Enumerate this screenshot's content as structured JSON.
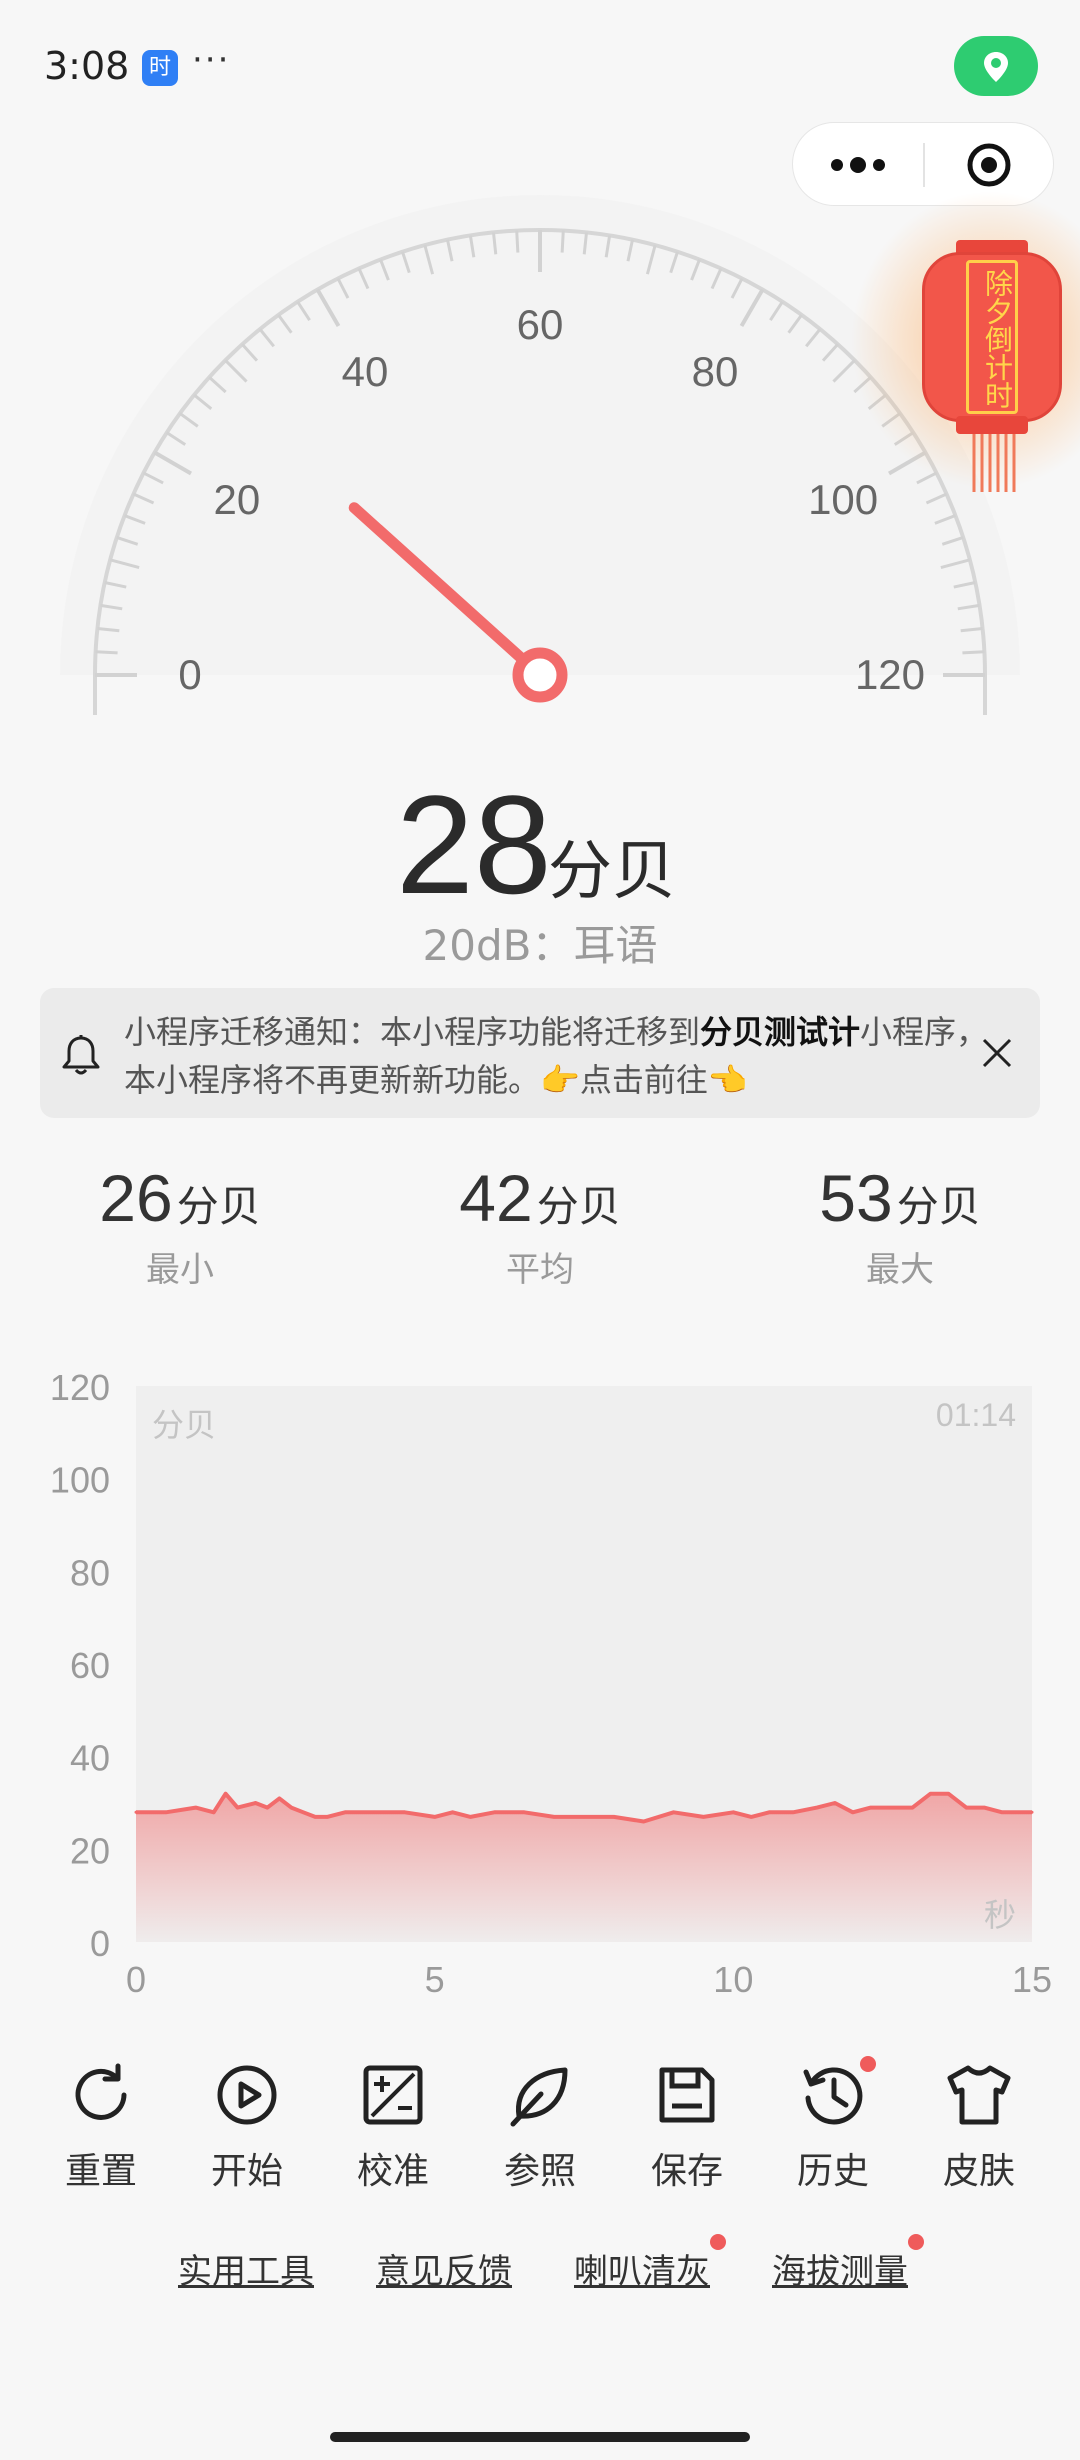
{
  "status_bar": {
    "time": "3:08",
    "app_icon_char": "时",
    "more": "···"
  },
  "gauge": {
    "ticks": [
      "0",
      "20",
      "40",
      "60",
      "80",
      "100",
      "120"
    ],
    "min": 0,
    "max": 120,
    "needle_value": 28
  },
  "lantern": {
    "label": "除夕倒计时"
  },
  "reading": {
    "value": "28",
    "unit": "分贝",
    "level": "20dB：耳语"
  },
  "notice": {
    "prefix": "小程序迁移通知：本小程序功能将迁移到",
    "highlight": "分贝测试计",
    "suffix": "小程序，本小程序将不再更新新功能。👉点击前往👈"
  },
  "stats": [
    {
      "value": "26",
      "unit": "分贝",
      "label": "最小"
    },
    {
      "value": "42",
      "unit": "分贝",
      "label": "平均"
    },
    {
      "value": "53",
      "unit": "分贝",
      "label": "最大"
    }
  ],
  "chart_data": {
    "type": "area",
    "ylabel": "分贝",
    "xlabel": "秒",
    "timestamp": "01:14",
    "ylim": [
      0,
      120
    ],
    "xlim": [
      0,
      15
    ],
    "y_ticks": [
      "120",
      "100",
      "80",
      "60",
      "40",
      "20",
      "0"
    ],
    "x_ticks": [
      "0",
      "5",
      "10",
      "15"
    ],
    "x": [
      0,
      0.5,
      1.0,
      1.3,
      1.5,
      1.7,
      2.0,
      2.2,
      2.4,
      2.6,
      2.8,
      3.0,
      3.2,
      3.5,
      4.0,
      4.5,
      5.0,
      5.3,
      5.6,
      6.0,
      6.5,
      7.0,
      7.5,
      8.0,
      8.5,
      9.0,
      9.5,
      10.0,
      10.3,
      10.6,
      11.0,
      11.4,
      11.7,
      12.0,
      12.3,
      12.6,
      13.0,
      13.3,
      13.6,
      13.9,
      14.2,
      14.5,
      15.0
    ],
    "values": [
      28,
      28,
      29,
      28,
      32,
      29,
      30,
      29,
      31,
      29,
      28,
      27,
      27,
      28,
      28,
      28,
      27,
      28,
      27,
      28,
      28,
      27,
      27,
      27,
      26,
      28,
      27,
      28,
      27,
      28,
      28,
      29,
      30,
      28,
      29,
      29,
      29,
      32,
      32,
      29,
      29,
      28,
      28
    ],
    "line_color": "#f26b6b"
  },
  "toolbar": [
    {
      "name": "reset",
      "label": "重置",
      "icon": "refresh-icon"
    },
    {
      "name": "start",
      "label": "开始",
      "icon": "play-icon"
    },
    {
      "name": "calibrate",
      "label": "校准",
      "icon": "calibrate-icon"
    },
    {
      "name": "reference",
      "label": "参照",
      "icon": "leaf-icon"
    },
    {
      "name": "save",
      "label": "保存",
      "icon": "save-icon"
    },
    {
      "name": "history",
      "label": "历史",
      "icon": "history-icon"
    },
    {
      "name": "skin",
      "label": "皮肤",
      "icon": "shirt-icon"
    }
  ],
  "links": [
    {
      "label": "实用工具"
    },
    {
      "label": "意见反馈"
    },
    {
      "label": "喇叭清灰"
    },
    {
      "label": "海拔测量"
    }
  ],
  "colors": {
    "accent": "#f26b6b",
    "green": "#2ecc71",
    "gauge_tick": "#d8d8d8"
  }
}
